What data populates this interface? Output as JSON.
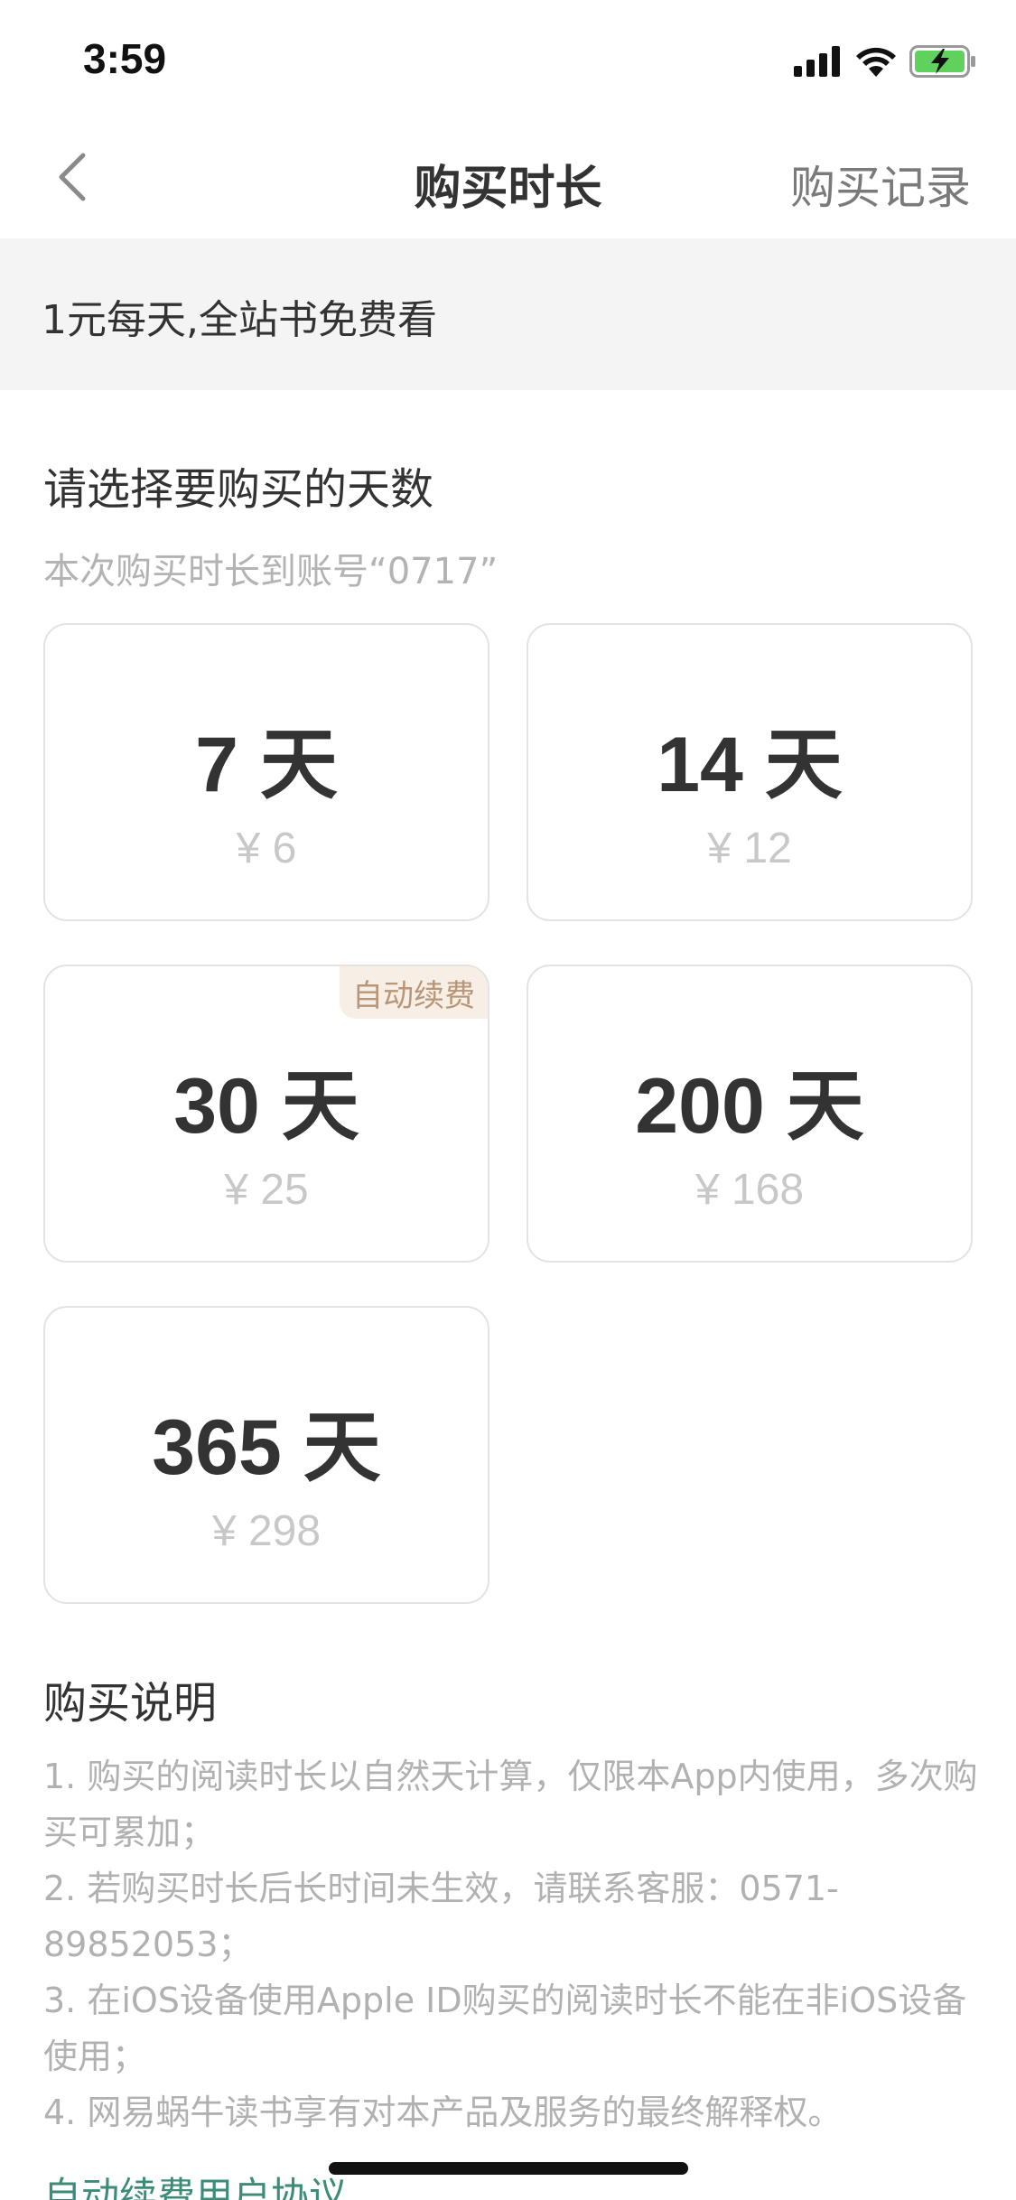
{
  "status_bar": {
    "time": "3:59"
  },
  "nav": {
    "title": "购买时长",
    "right_label": "购买记录"
  },
  "banner": {
    "text": "1元每天,全站书免费看"
  },
  "choose": {
    "title": "请选择要购买的天数",
    "subtitle": "本次购买时长到账号“0717”"
  },
  "plans": [
    {
      "days": "7 天",
      "price": "¥ 6",
      "badge": ""
    },
    {
      "days": "14 天",
      "price": "¥ 12",
      "badge": ""
    },
    {
      "days": "30 天",
      "price": "¥ 25",
      "badge": "自动续费"
    },
    {
      "days": "200 天",
      "price": "¥ 168",
      "badge": ""
    },
    {
      "days": "365 天",
      "price": "¥ 298",
      "badge": ""
    }
  ],
  "notes": {
    "title": "购买说明",
    "items": [
      "1. 购买的阅读时长以自然天计算，仅限本App内使用，多次购买可累加；",
      "2. 若购买时长后长时间未生效，请联系客服：0571-89852053；",
      "3. 在iOS设备使用Apple ID购买的阅读时长不能在非iOS设备使用；",
      "4. 网易蜗牛读书享有对本产品及服务的最终解释权。"
    ]
  },
  "agreement_link": "自动续费用户协议",
  "colors": {
    "accent_link": "#3d8b79",
    "badge_bg": "#f7efe6",
    "badge_text": "#b89677",
    "battery_green": "#5fd15c"
  },
  "icons": {
    "back": "chevron-left-icon",
    "signal": "cellular-signal-icon",
    "wifi": "wifi-icon",
    "battery": "battery-charging-icon"
  }
}
